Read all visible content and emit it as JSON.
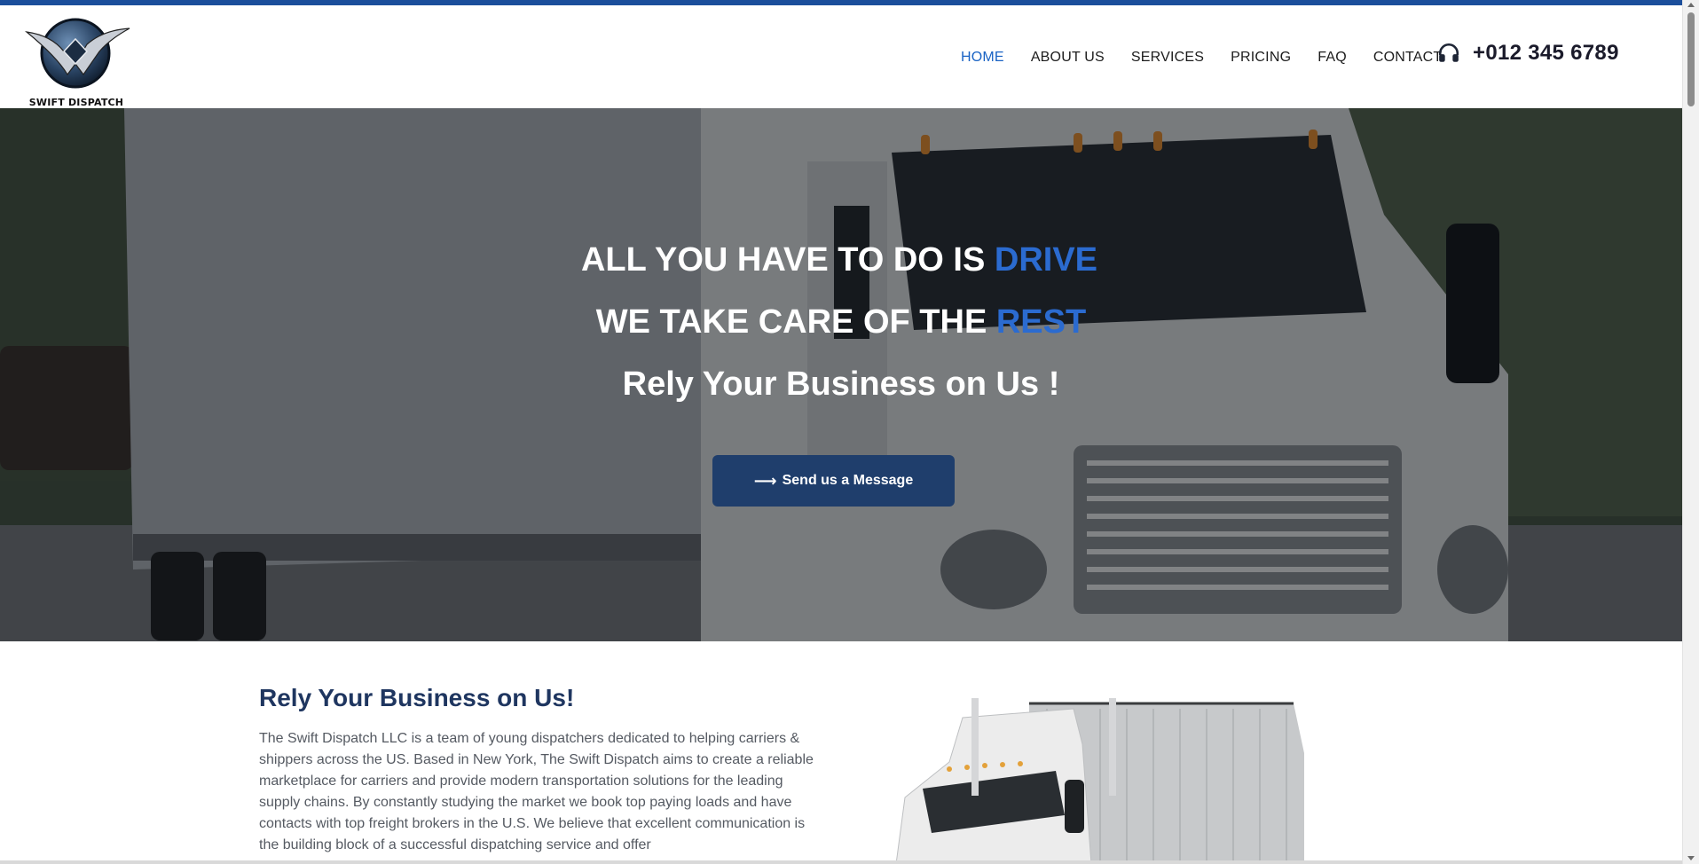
{
  "brand": {
    "name": "SWIFT DISPATCH",
    "accent_color": "#1b4e9b"
  },
  "nav": {
    "items": [
      {
        "label": "HOME",
        "active": true
      },
      {
        "label": "ABOUT US",
        "active": false
      },
      {
        "label": "SERVICES",
        "active": false
      },
      {
        "label": "PRICING",
        "active": false
      },
      {
        "label": "FAQ",
        "active": false
      },
      {
        "label": "CONTACT",
        "active": false
      }
    ],
    "phone_icon": "headphones-icon",
    "phone": "+012 345 6789"
  },
  "hero": {
    "line1_main": "ALL YOU HAVE TO DO IS ",
    "line1_accent": "DRIVE",
    "line2_main": "WE TAKE CARE OF THE ",
    "line2_accent": "REST",
    "line3": "Rely Your Business on Us !",
    "cta_label": "Send us a Message",
    "cta_icon": "arrow-right-icon",
    "accent_color": "#2b6bd0"
  },
  "about": {
    "title": "Rely Your Business on Us!",
    "text": "The Swift Dispatch LLC is a team of young dispatchers dedicated to helping carriers & shippers across the US. Based in New York, The Swift Dispatch aims to create a reliable marketplace for carriers and provide modern transportation solutions for the leading supply chains. By constantly studying the market we book top paying loads and have contacts with top freight brokers in the U.S. We believe that excellent communication is the building block of a successful dispatching service and offer"
  }
}
